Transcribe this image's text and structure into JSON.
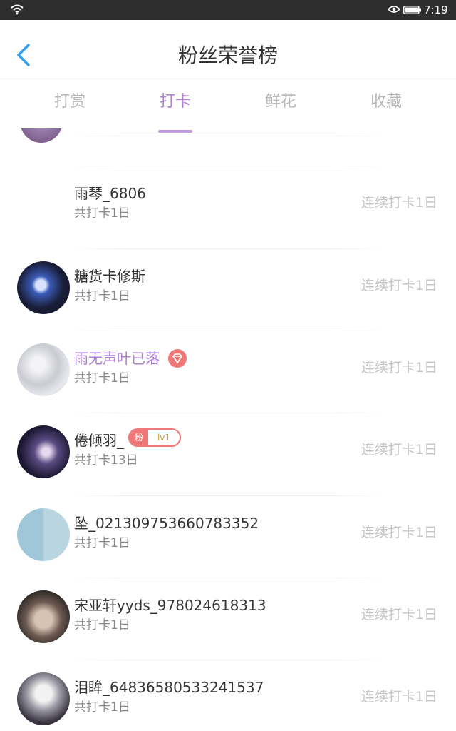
{
  "status_bar": {
    "time": "7:19"
  },
  "header": {
    "title": "粉丝荣誉榜"
  },
  "tabs": [
    {
      "label": "打赏",
      "active": false
    },
    {
      "label": "打卡",
      "active": true
    },
    {
      "label": "鲜花",
      "active": false
    },
    {
      "label": "收藏",
      "active": false
    }
  ],
  "rows": [
    {
      "name": "雨琴_6806",
      "total": "共打卡1日",
      "streak": "连续打卡1日",
      "avatar": "none"
    },
    {
      "name": "糖货卡修斯",
      "total": "共打卡1日",
      "streak": "连续打卡1日",
      "avatar": "anime-dark-blue"
    },
    {
      "name": "雨无声叶已落",
      "total": "共打卡1日",
      "streak": "连续打卡1日",
      "avatar": "silver-foil",
      "vip": true
    },
    {
      "name": "倦倾羽_",
      "total": "共打卡13日",
      "streak": "连续打卡1日",
      "avatar": "anime-navy",
      "fan_badge": {
        "label": "粉",
        "level": "lv1"
      }
    },
    {
      "name": "坠_021309753660783352",
      "total": "共打卡1日",
      "streak": "连续打卡1日",
      "avatar": "book-cover"
    },
    {
      "name": "宋亚轩yyds_978024618313",
      "total": "共打卡1日",
      "streak": "连续打卡1日",
      "avatar": "portrait"
    },
    {
      "name": "泪眸_64836580533241537",
      "total": "共打卡1日",
      "streak": "连续打卡1日",
      "avatar": "anime-white-hair"
    }
  ],
  "colors": {
    "accent": "#b07fd6",
    "badge_red": "#ef7777",
    "back_arrow": "#2f9ef0"
  }
}
